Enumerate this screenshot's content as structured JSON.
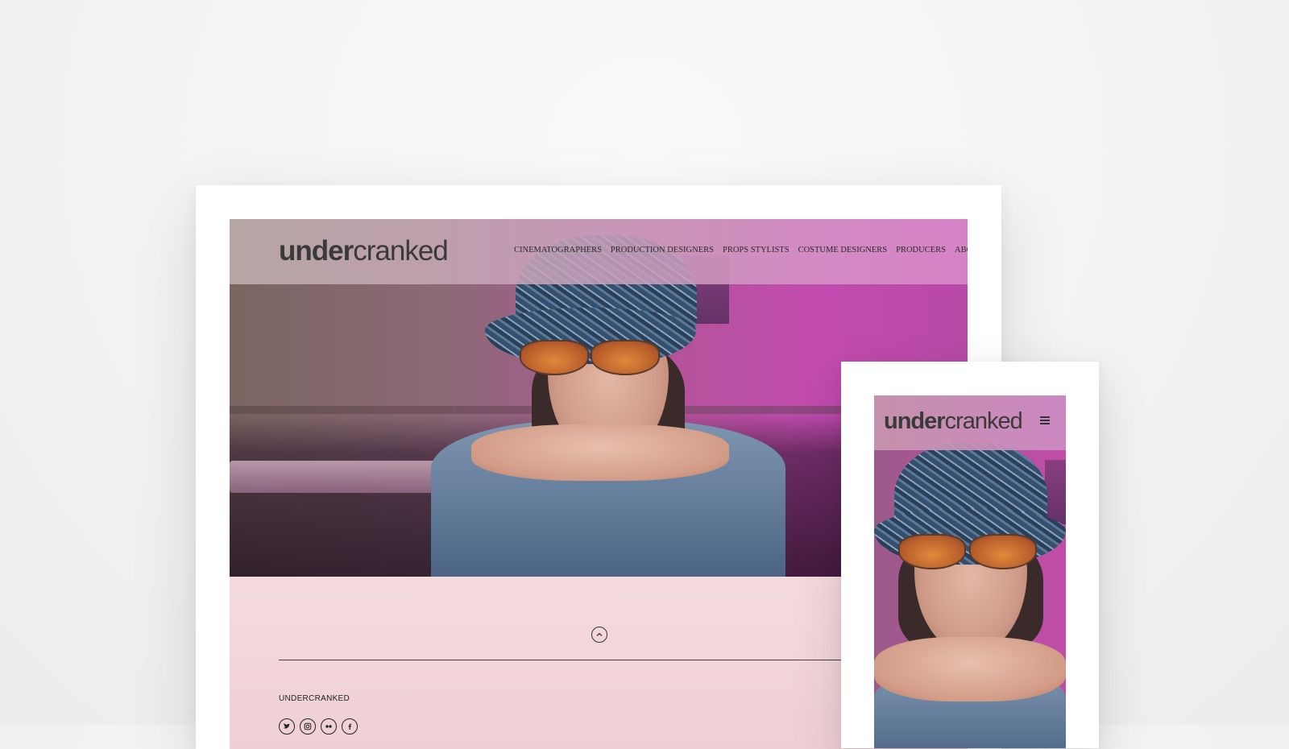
{
  "desktop": {
    "logo": {
      "light_part": "cranked",
      "bold_part": "under"
    },
    "nav": [
      "CINEMATOGRAPHERS",
      "PRODUCTION DESIGNERS",
      "PROPS STYLISTS",
      "COSTUME DESIGNERS",
      "PRODUCERS",
      "ABOUT"
    ],
    "footer": {
      "scroll_top_icon": "chevron-up-circle-icon",
      "brand": "UNDERCRANKED",
      "socials": [
        "twitter-icon",
        "instagram-icon",
        "flickr-icon",
        "facebook-icon"
      ]
    }
  },
  "mobile": {
    "logo": {
      "light_part": "cranked",
      "bold_part": "under"
    },
    "menu_icon": "hamburger-icon"
  },
  "colors": {
    "footer_bg": "#f3d8dc",
    "accent_magenta": "#c24bb0",
    "text_dark": "#2a2a2a"
  }
}
